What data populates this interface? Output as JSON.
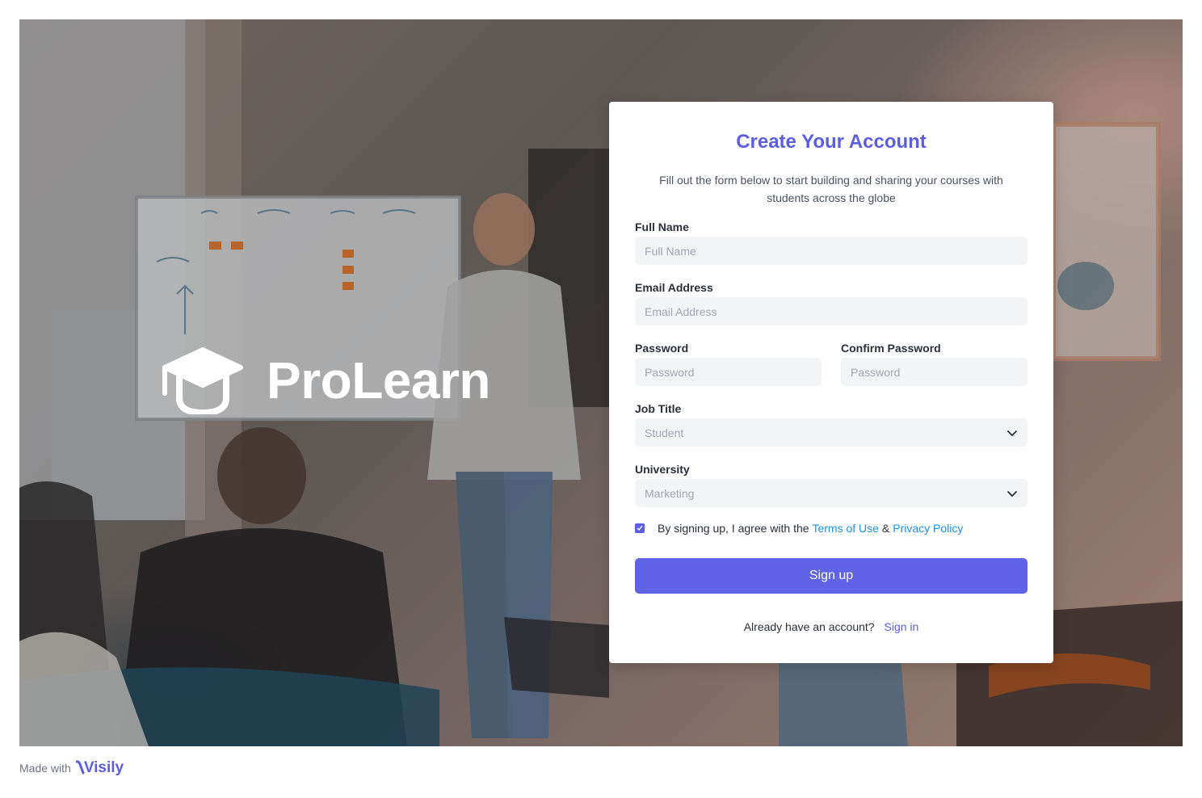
{
  "brand": {
    "name": "ProLearn",
    "icon": "graduation-cap-icon"
  },
  "form": {
    "title": "Create Your Account",
    "subtitle": "Fill out the form below to start building and sharing your courses with students across the globe",
    "full_name": {
      "label": "Full Name",
      "placeholder": "Full Name"
    },
    "email": {
      "label": "Email Address",
      "placeholder": "Email Address"
    },
    "password": {
      "label": "Password",
      "placeholder": "Password"
    },
    "confirm_password": {
      "label": "Confirm Password",
      "placeholder": "Password"
    },
    "job_title": {
      "label": "Job Title",
      "value": "Student"
    },
    "university": {
      "label": "University",
      "value": "Marketing"
    },
    "agree": {
      "checked": true,
      "text": "By signing up, I agree with the",
      "terms": "Terms of Use",
      "amp": "&",
      "privacy": "Privacy Policy"
    },
    "submit_label": "Sign up",
    "have_account": "Already have an account?",
    "sign_in": "Sign in"
  },
  "footer": {
    "made_with": "Made with",
    "visily": "Visily"
  },
  "colors": {
    "accent": "#5b5ee0",
    "button": "#5f63e6",
    "link": "#1f8fe0",
    "field_bg": "#f3f4f6"
  }
}
